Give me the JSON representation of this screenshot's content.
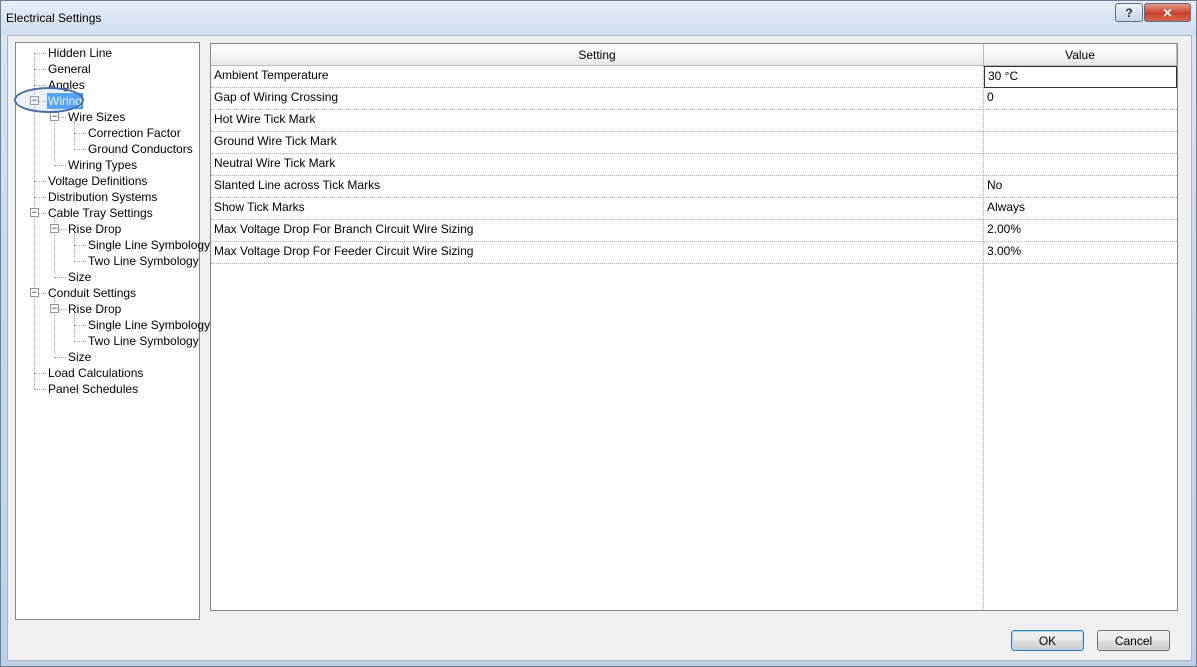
{
  "window": {
    "title": "Electrical Settings",
    "help_label": "?",
    "close_label": "✕"
  },
  "tree": {
    "items": [
      {
        "label": "Hidden Line"
      },
      {
        "label": "General"
      },
      {
        "label": "Angles"
      },
      {
        "label": "Wiring",
        "selected": true,
        "expanded": true
      },
      {
        "label": "Wire Sizes",
        "expanded": true
      },
      {
        "label": "Correction Factor"
      },
      {
        "label": "Ground Conductors"
      },
      {
        "label": "Wiring Types"
      },
      {
        "label": "Voltage Definitions"
      },
      {
        "label": "Distribution Systems"
      },
      {
        "label": "Cable Tray Settings",
        "expanded": true
      },
      {
        "label": "Rise Drop",
        "expanded": true
      },
      {
        "label": "Single Line Symbology"
      },
      {
        "label": "Two Line Symbology"
      },
      {
        "label": "Size"
      },
      {
        "label": "Conduit Settings",
        "expanded": true
      },
      {
        "label": "Rise Drop",
        "expanded": true
      },
      {
        "label": "Single Line Symbology"
      },
      {
        "label": "Two Line Symbology"
      },
      {
        "label": "Size"
      },
      {
        "label": "Load Calculations"
      },
      {
        "label": "Panel Schedules"
      }
    ]
  },
  "grid": {
    "columns": [
      "Setting",
      "Value"
    ],
    "rows": [
      {
        "setting": "Ambient Temperature",
        "value": "30 °C"
      },
      {
        "setting": "Gap of Wiring Crossing",
        "value": "0"
      },
      {
        "setting": "Hot Wire Tick Mark",
        "value": ""
      },
      {
        "setting": "Ground Wire Tick Mark",
        "value": ""
      },
      {
        "setting": "Neutral Wire Tick Mark",
        "value": ""
      },
      {
        "setting": "Slanted Line across Tick Marks",
        "value": "No"
      },
      {
        "setting": "Show Tick Marks",
        "value": "Always"
      },
      {
        "setting": "Max Voltage Drop For Branch Circuit Wire Sizing",
        "value": "2.00%"
      },
      {
        "setting": "Max Voltage Drop For Feeder Circuit Wire Sizing",
        "value": "3.00%"
      }
    ]
  },
  "buttons": {
    "ok": "OK",
    "cancel": "Cancel"
  }
}
